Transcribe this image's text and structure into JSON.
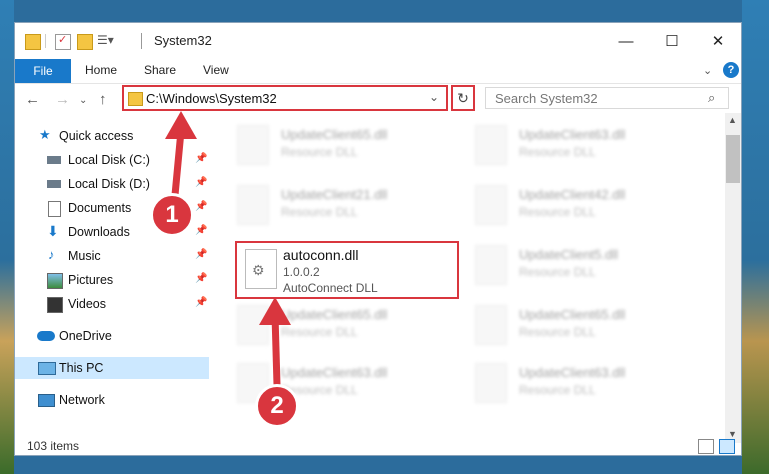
{
  "window": {
    "title": "System32",
    "controls": {
      "minimize": "—",
      "maximize": "☐",
      "close": "✕"
    }
  },
  "ribbon": {
    "file": "File",
    "tabs": [
      "Home",
      "Share",
      "View"
    ],
    "help": "?"
  },
  "address": {
    "path": "C:\\Windows\\System32",
    "search_placeholder": "Search System32"
  },
  "nav": {
    "quick_access": "Quick access",
    "items": [
      {
        "label": "Local Disk (C:)",
        "icon": "drive-icon"
      },
      {
        "label": "Local Disk (D:)",
        "icon": "drive-icon"
      },
      {
        "label": "Documents",
        "icon": "document-icon"
      },
      {
        "label": "Downloads",
        "icon": "download-icon"
      },
      {
        "label": "Music",
        "icon": "music-icon"
      },
      {
        "label": "Pictures",
        "icon": "picture-icon"
      },
      {
        "label": "Videos",
        "icon": "video-icon"
      }
    ],
    "onedrive": "OneDrive",
    "this_pc": "This PC",
    "network": "Network"
  },
  "files": {
    "left": [
      {
        "name": "UpdateClient65.dll",
        "sub": "Resource DLL"
      },
      {
        "name": "UpdateClient21.dll",
        "sub": "Resource DLL"
      },
      {
        "name": "UpdateClient65.dll",
        "sub": "Resource DLL"
      },
      {
        "name": "UpdateClient63.dll",
        "sub": "Resource DLL"
      }
    ],
    "right": [
      {
        "name": "UpdateClient63.dll",
        "sub": "Resource DLL"
      },
      {
        "name": "UpdateClient42.dll",
        "sub": "Resource DLL"
      },
      {
        "name": "UpdateClient5.dll",
        "sub": "Resource DLL"
      },
      {
        "name": "UpdateClient65.dll",
        "sub": "Resource DLL"
      },
      {
        "name": "UpdateClient63.dll",
        "sub": "Resource DLL"
      }
    ],
    "selected": {
      "name": "autoconn.dll",
      "version": "1.0.0.2",
      "desc": "AutoConnect DLL"
    }
  },
  "status": {
    "count": "103 items"
  },
  "callouts": {
    "one": "1",
    "two": "2"
  },
  "colors": {
    "accent": "#1979ca",
    "highlight": "#d9363e",
    "selected_nav": "#cce8ff"
  }
}
